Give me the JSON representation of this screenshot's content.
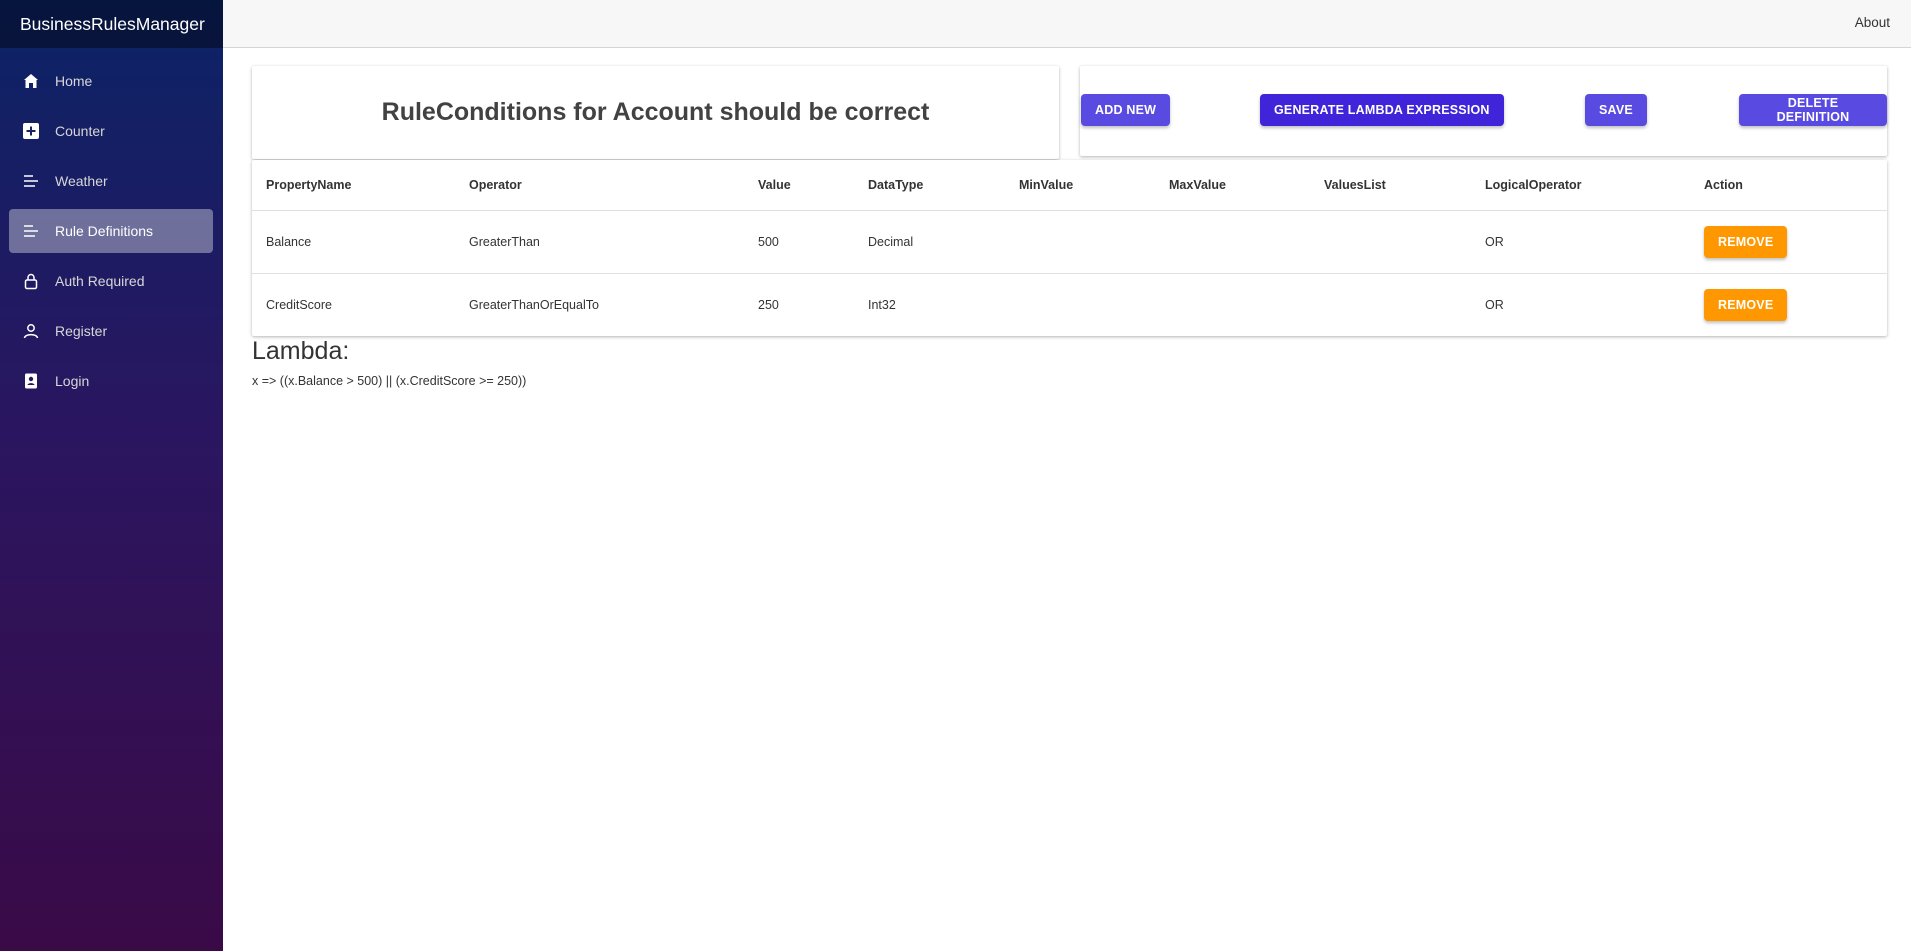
{
  "app": {
    "brand": "BusinessRulesManager"
  },
  "sidebar": {
    "items": [
      {
        "label": "Home",
        "icon": "home-icon",
        "active": false
      },
      {
        "label": "Counter",
        "icon": "plus-square-icon",
        "active": false
      },
      {
        "label": "Weather",
        "icon": "list-icon",
        "active": false
      },
      {
        "label": "Rule Definitions",
        "icon": "list-icon",
        "active": true
      },
      {
        "label": "Auth Required",
        "icon": "lock-icon",
        "active": false
      },
      {
        "label": "Register",
        "icon": "person-icon",
        "active": false
      },
      {
        "label": "Login",
        "icon": "badge-icon",
        "active": false
      }
    ]
  },
  "topbar": {
    "about": "About"
  },
  "page": {
    "title": "RuleConditions for Account should be correct",
    "buttons": {
      "add_new": "ADD NEW",
      "generate": "GENERATE LAMBDA EXPRESSION",
      "save": "SAVE",
      "delete": "DELETE DEFINITION"
    },
    "table": {
      "headers": [
        "PropertyName",
        "Operator",
        "Value",
        "DataType",
        "MinValue",
        "MaxValue",
        "ValuesList",
        "LogicalOperator",
        "Action"
      ],
      "rows": [
        {
          "property": "Balance",
          "operator": "GreaterThan",
          "value": "500",
          "datatype": "Decimal",
          "min": "",
          "max": "",
          "values": "",
          "logical": "OR",
          "action": "REMOVE"
        },
        {
          "property": "CreditScore",
          "operator": "GreaterThanOrEqualTo",
          "value": "250",
          "datatype": "Int32",
          "min": "",
          "max": "",
          "values": "",
          "logical": "OR",
          "action": "REMOVE"
        }
      ]
    },
    "lambda_heading": "Lambda:",
    "lambda_expression": "x => ((x.Balance > 500) || (x.CreditScore >= 250))"
  },
  "colors": {
    "primary": "#594ae2",
    "primary_dark": "#3f24d9",
    "warning": "#ff9800"
  }
}
